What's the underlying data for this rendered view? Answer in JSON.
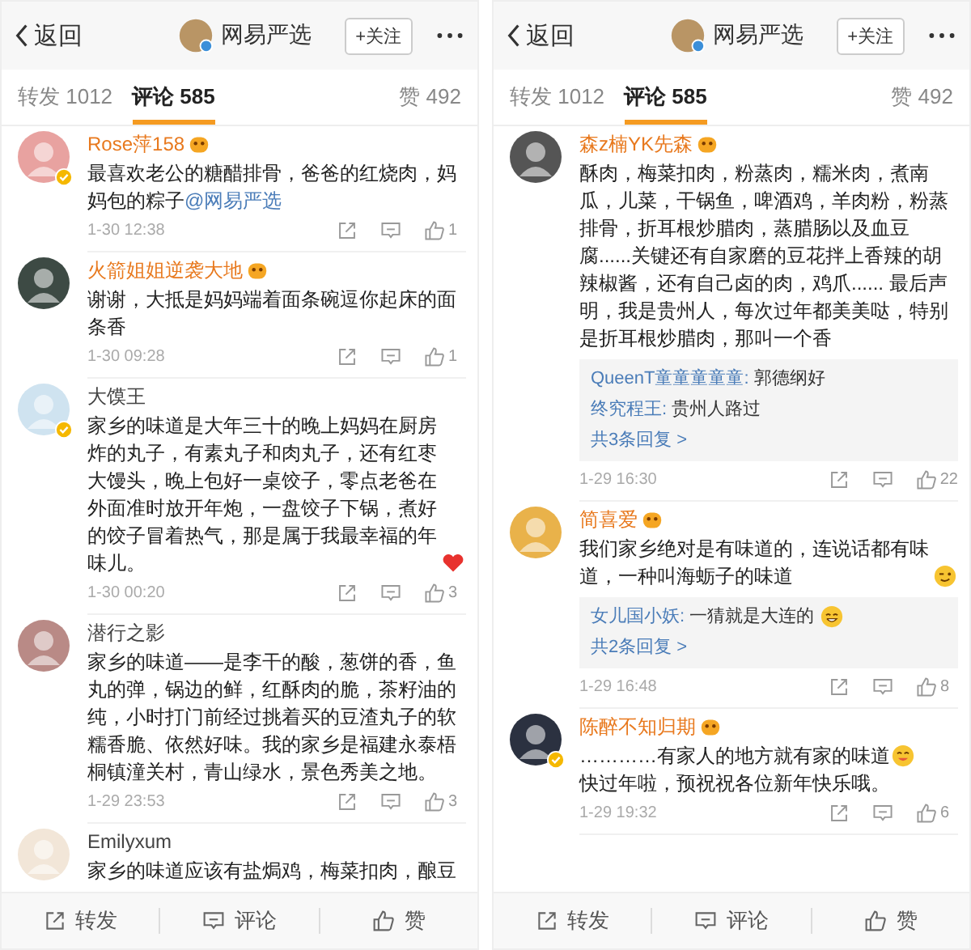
{
  "screens": [
    {
      "header": {
        "back": "返回",
        "account": "网易严选",
        "follow": "+关注"
      },
      "tabs": [
        {
          "label": "转发 1012",
          "selected": false
        },
        {
          "label": "评论 585",
          "selected": true
        },
        {
          "label": "赞 492",
          "selected": false
        }
      ],
      "comments": [
        {
          "user": "Rose萍158",
          "member": true,
          "verified": true,
          "text": [
            {
              "kind": "text",
              "text": "最喜欢老公的糖醋排骨，爸爸的红烧肉，妈妈包的粽子"
            },
            {
              "kind": "mention",
              "text": "@网易严选"
            }
          ],
          "time": "1-30 12:38",
          "likes": "1"
        },
        {
          "user": "火箭姐姐逆袭大地",
          "member": true,
          "verified": false,
          "text": [
            {
              "kind": "text",
              "text": "谢谢，大抵是妈妈端着面条碗逗你起床的面条香"
            }
          ],
          "time": "1-30 09:28",
          "likes": "1"
        },
        {
          "user": "大馍王",
          "member": false,
          "verified": true,
          "text": [
            {
              "kind": "text",
              "text": "家乡的味道是大年三十的晚上妈妈在厨房炸的丸子，有素丸子和肉丸子，还有红枣大馒头，晚上包好一桌饺子，零点老爸在外面准时放开年炮，一盘饺子下锅，煮好的饺子冒着热气，那是属于我最幸福的年味儿。"
            },
            {
              "kind": "heart"
            }
          ],
          "time": "1-30 00:20",
          "likes": "3"
        },
        {
          "user": "潜行之影",
          "member": false,
          "verified": false,
          "text": [
            {
              "kind": "text",
              "text": "家乡的味道——是李干的酸，葱饼的香，鱼丸的弹，锅边的鲜，红酥肉的脆，茶籽油的纯，小时打门前经过挑着买的豆渣丸子的软糯香脆、依然好味。我的家乡是福建永泰梧桐镇潼关村，青山绿水，景色秀美之地。"
            }
          ],
          "time": "1-29 23:53",
          "likes": "3"
        },
        {
          "user": "Emilyxum",
          "member": false,
          "verified": false,
          "text": [
            {
              "kind": "text",
              "text": "家乡的味道应该有盐焗鸡，梅菜扣肉，酿豆"
            }
          ]
        }
      ],
      "actions": [
        {
          "label": "转发",
          "kind": "repost"
        },
        {
          "label": "评论",
          "kind": "comment"
        },
        {
          "label": "赞",
          "kind": "like"
        }
      ]
    },
    {
      "header": {
        "back": "返回",
        "account": "网易严选",
        "follow": "+关注"
      },
      "tabs": [
        {
          "label": "转发 1012",
          "selected": false
        },
        {
          "label": "评论 585",
          "selected": true
        },
        {
          "label": "赞 492",
          "selected": false
        }
      ],
      "comments": [
        {
          "user": "森z楠YK先森",
          "member": true,
          "verified": false,
          "text": [
            {
              "kind": "text",
              "text": "酥肉，梅菜扣肉，粉蒸肉，糯米肉，煮南瓜，儿菜，干锅鱼，啤酒鸡，羊肉粉，粉蒸排骨，折耳根炒腊肉，蒸腊肠以及血豆腐......关键还有自家磨的豆花拌上香辣的胡辣椒酱，还有自己卤的肉，鸡爪...... 最后声明，我是贵州人，每次过年都美美哒，特别是折耳根炒腊肉，那叫一个香"
            }
          ],
          "replies": [
            {
              "user": "QueenT童童童童童:",
              "text": [
                {
                  "kind": "text",
                  "text": "郭德纲好"
                }
              ]
            },
            {
              "user": "终究程王:",
              "text": [
                {
                  "kind": "text",
                  "text": "贵州人路过"
                }
              ]
            }
          ],
          "more": "共3条回复 >",
          "time": "1-29 16:30",
          "likes": "22"
        },
        {
          "user": "简喜爱",
          "member": true,
          "verified": false,
          "text": [
            {
              "kind": "text",
              "text": "我们家乡绝对是有味道的，连说话都有味道，一种叫海蛎子的味道"
            },
            {
              "kind": "wink"
            }
          ],
          "replies": [
            {
              "user": "女儿国小妖:",
              "text": [
                {
                  "kind": "text",
                  "text": "一猜就是大连的"
                },
                {
                  "kind": "grin"
                }
              ]
            }
          ],
          "more": "共2条回复 >",
          "time": "1-29 16:48",
          "likes": "8"
        },
        {
          "user": "陈醉不知归期",
          "member": true,
          "verified": true,
          "text": [
            {
              "kind": "text",
              "text": "…………有家人的地方就有家的味道"
            },
            {
              "kind": "smile"
            },
            {
              "kind": "text",
              "text": "快过年啦，预祝祝各位新年快乐哦。"
            }
          ],
          "time": "1-29 19:32",
          "likes": "6"
        }
      ],
      "actions": [
        {
          "label": "转发",
          "kind": "repost"
        },
        {
          "label": "评论",
          "kind": "comment"
        },
        {
          "label": "赞",
          "kind": "like"
        }
      ]
    }
  ]
}
